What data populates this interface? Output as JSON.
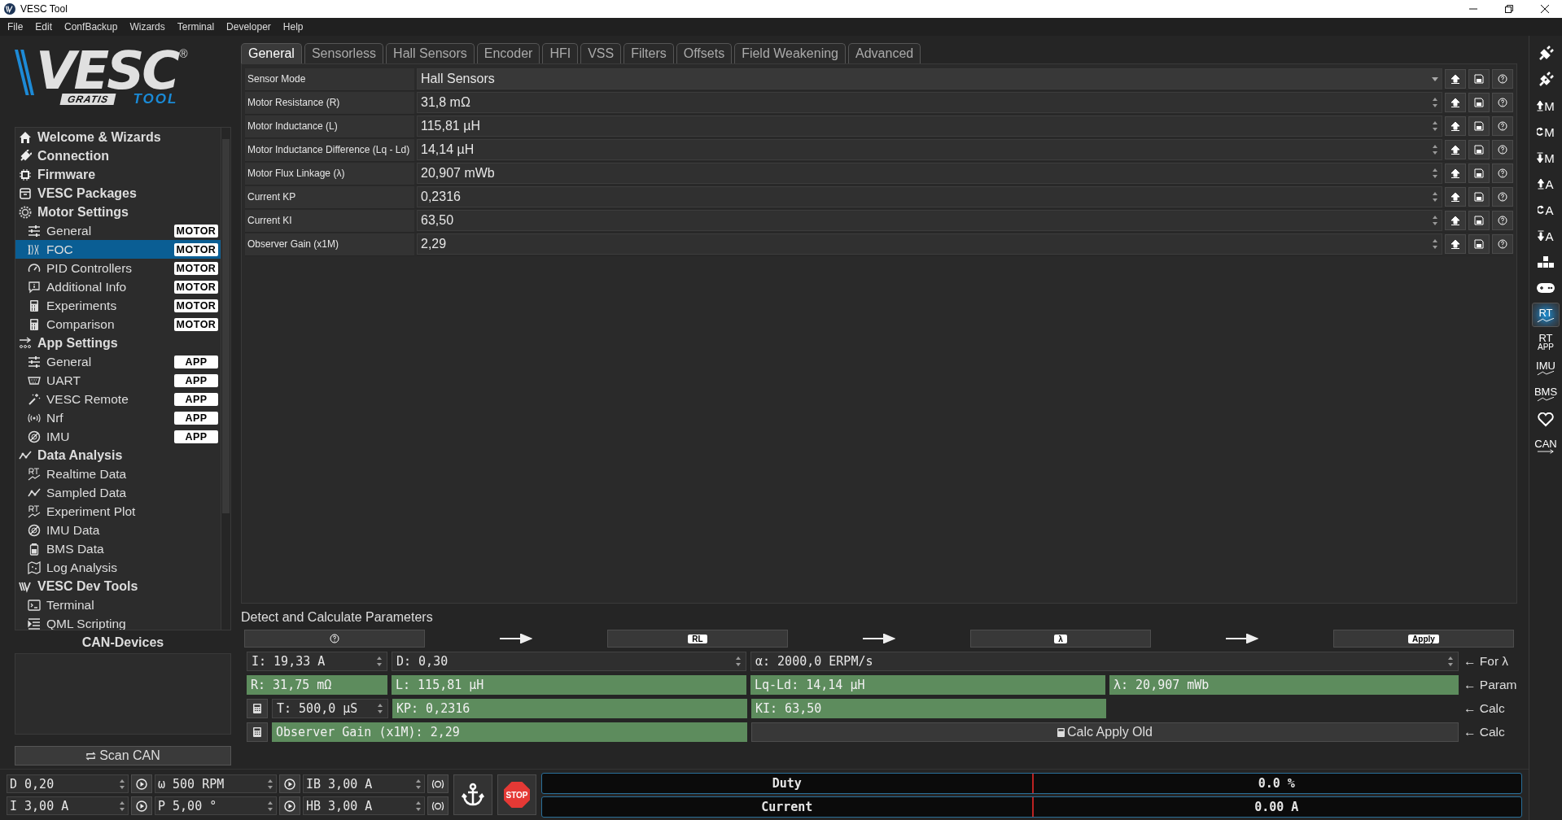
{
  "window": {
    "title": "VESC Tool"
  },
  "menu": [
    "File",
    "Edit",
    "ConfBackup",
    "Wizards",
    "Terminal",
    "Developer",
    "Help"
  ],
  "logo": {
    "wordmark": "VESC",
    "registered": "®",
    "badge": "GRATIS",
    "subtitle": "TOOL"
  },
  "sidebar": {
    "items": [
      {
        "label": "Welcome & Wizards",
        "kind": "home"
      },
      {
        "label": "Connection",
        "kind": "plug"
      },
      {
        "label": "Firmware",
        "kind": "chip"
      },
      {
        "label": "VESC Packages",
        "kind": "package"
      },
      {
        "label": "Motor Settings",
        "kind": "motor",
        "children": [
          {
            "label": "General",
            "kind": "sliders",
            "badge": "MOTOR",
            "selected": false
          },
          {
            "label": "FOC",
            "kind": "wave",
            "badge": "MOTOR",
            "selected": true
          },
          {
            "label": "PID Controllers",
            "kind": "gauge",
            "badge": "MOTOR",
            "selected": false
          },
          {
            "label": "Additional Info",
            "kind": "info",
            "badge": "MOTOR",
            "selected": false
          },
          {
            "label": "Experiments",
            "kind": "calc",
            "badge": "MOTOR",
            "selected": false
          },
          {
            "label": "Comparison",
            "kind": "calc",
            "badge": "MOTOR",
            "selected": false
          }
        ]
      },
      {
        "label": "App Settings",
        "kind": "arrows",
        "children": [
          {
            "label": "General",
            "kind": "sliders",
            "badge": "APP",
            "selected": false
          },
          {
            "label": "UART",
            "kind": "serial",
            "badge": "APP",
            "selected": false
          },
          {
            "label": "VESC Remote",
            "kind": "wand",
            "badge": "APP",
            "selected": false
          },
          {
            "label": "Nrf",
            "kind": "radio",
            "badge": "APP",
            "selected": false
          },
          {
            "label": "IMU",
            "kind": "imu",
            "badge": "APP",
            "selected": false
          }
        ]
      },
      {
        "label": "Data Analysis",
        "kind": "chart",
        "children": [
          {
            "label": "Realtime Data",
            "kind": "rt",
            "selected": false
          },
          {
            "label": "Sampled Data",
            "kind": "chart",
            "selected": false
          },
          {
            "label": "Experiment Plot",
            "kind": "rt",
            "selected": false
          },
          {
            "label": "IMU Data",
            "kind": "imu",
            "selected": false
          },
          {
            "label": "BMS Data",
            "kind": "battery",
            "selected": false
          },
          {
            "label": "Log Analysis",
            "kind": "map",
            "selected": false
          }
        ]
      },
      {
        "label": "VESC Dev Tools",
        "kind": "vesc",
        "children": [
          {
            "label": "Terminal",
            "kind": "terminal",
            "selected": false
          },
          {
            "label": "QML Scripting",
            "kind": "script",
            "selected": false
          }
        ]
      }
    ]
  },
  "can_devices": {
    "title": "CAN-Devices",
    "button": "Scan CAN"
  },
  "tabs": [
    {
      "label": "General",
      "selected": true
    },
    {
      "label": "Sensorless",
      "selected": false
    },
    {
      "label": "Hall Sensors",
      "selected": false
    },
    {
      "label": "Encoder",
      "selected": false
    },
    {
      "label": "HFI",
      "selected": false
    },
    {
      "label": "VSS",
      "selected": false
    },
    {
      "label": "Filters",
      "selected": false
    },
    {
      "label": "Offsets",
      "selected": false
    },
    {
      "label": "Field Weakening",
      "selected": false
    },
    {
      "label": "Advanced",
      "selected": false
    }
  ],
  "parameters": [
    {
      "label": "Sensor Mode",
      "value": "Hall Sensors",
      "kind": "dropdown"
    },
    {
      "label": "Motor Resistance (R)",
      "value": "31,8 mΩ",
      "kind": "spin"
    },
    {
      "label": "Motor Inductance (L)",
      "value": "115,81 µH",
      "kind": "spin"
    },
    {
      "label": "Motor Inductance Difference (Lq - Ld)",
      "value": "14,14 µH",
      "kind": "spin"
    },
    {
      "label": "Motor Flux Linkage (λ)",
      "value": "20,907 mWb",
      "kind": "spin"
    },
    {
      "label": "Current KP",
      "value": "0,2316",
      "kind": "spin"
    },
    {
      "label": "Current KI",
      "value": "63,50",
      "kind": "spin"
    },
    {
      "label": "Observer Gain (x1M)",
      "value": "2,29",
      "kind": "spin"
    }
  ],
  "detect": {
    "title": "Detect and Calculate Parameters",
    "steps": [
      {
        "kind": "help"
      },
      {
        "kind": "arrow"
      },
      {
        "kind": "button",
        "label": "RL"
      },
      {
        "kind": "arrow"
      },
      {
        "kind": "button",
        "label": "λ"
      },
      {
        "kind": "arrow"
      },
      {
        "kind": "button",
        "label": "Apply"
      }
    ],
    "rows": [
      {
        "kind": "inputs",
        "note": "← For λ",
        "fields": [
          {
            "kind": "spin",
            "text": "I: 19,33 A"
          },
          {
            "kind": "spin",
            "text": "D: 0,30"
          },
          {
            "kind": "spin",
            "text": "α: 2000,0 ERPM/s"
          }
        ]
      },
      {
        "kind": "params",
        "note": "← Param",
        "fields": [
          {
            "kind": "result",
            "text": "R: 31,75 mΩ"
          },
          {
            "kind": "result",
            "text": "L: 115,81 µH"
          },
          {
            "kind": "result",
            "text": "Lq-Ld: 14,14 µH"
          },
          {
            "kind": "result",
            "text": "λ: 20,907 mWb"
          }
        ]
      },
      {
        "kind": "calc",
        "note": "← Calc",
        "fields": [
          {
            "kind": "calc"
          },
          {
            "kind": "spin",
            "text": "T: 500,0 µS"
          },
          {
            "kind": "result",
            "text": "KP: 0,2316"
          },
          {
            "kind": "result",
            "text": "KI: 63,50"
          }
        ]
      },
      {
        "kind": "calc-wide",
        "note": "← Calc",
        "fields": [
          {
            "kind": "calc"
          },
          {
            "kind": "result",
            "text": "Observer Gain (x1M): 2,29"
          },
          {
            "kind": "button",
            "text": "Calc Apply Old"
          }
        ]
      }
    ]
  },
  "controls": [
    [
      {
        "kind": "spin",
        "text": "D 0,20"
      },
      {
        "kind": "play"
      },
      {
        "kind": "spin",
        "text": "ω 500 RPM"
      },
      {
        "kind": "play"
      },
      {
        "kind": "spin",
        "text": "IB 3,00 A"
      },
      {
        "kind": "brake"
      }
    ],
    [
      {
        "kind": "spin",
        "text": "I 3,00 A"
      },
      {
        "kind": "play"
      },
      {
        "kind": "spin",
        "text": "P 5,00 °"
      },
      {
        "kind": "play"
      },
      {
        "kind": "spin",
        "text": "HB 3,00 A"
      },
      {
        "kind": "brake"
      }
    ]
  ],
  "stop": {
    "label": "STOP"
  },
  "meters": [
    {
      "name": "Duty",
      "reading": "0.0 %"
    },
    {
      "name": "Current",
      "reading": "0.00 A"
    }
  ],
  "toolbar": [
    {
      "kind": "connect",
      "selected": false
    },
    {
      "kind": "disconnect",
      "selected": false
    },
    {
      "kind": "read",
      "label": "M",
      "selected": false
    },
    {
      "kind": "read-default",
      "label": "M",
      "selected": false
    },
    {
      "kind": "write",
      "label": "M",
      "selected": false
    },
    {
      "kind": "read",
      "label": "A",
      "selected": false
    },
    {
      "kind": "read-default",
      "label": "A",
      "selected": false
    },
    {
      "kind": "write",
      "label": "A",
      "selected": false
    },
    {
      "kind": "keys",
      "selected": false
    },
    {
      "kind": "gamepad",
      "selected": false
    },
    {
      "kind": "graph",
      "label": "RT",
      "selected": true
    },
    {
      "kind": "stack",
      "label": "RT",
      "sub": "APP",
      "selected": false
    },
    {
      "kind": "graph",
      "label": "IMU",
      "selected": false
    },
    {
      "kind": "graph",
      "label": "BMS",
      "selected": false
    },
    {
      "kind": "heart",
      "selected": false
    },
    {
      "kind": "arrow",
      "label": "CAN",
      "selected": false
    }
  ]
}
